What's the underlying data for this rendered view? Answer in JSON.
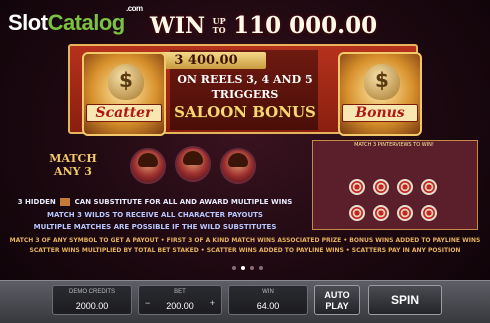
{
  "watermark": {
    "slot": "Slot",
    "catalog": "Catalog",
    "dotcom": ".com"
  },
  "headline": {
    "win": "WIN",
    "upto": "UP TO",
    "amount": "110 000.00"
  },
  "banner": {
    "bet_amount": "3 400.00",
    "line1": "ON REELS 3, 4 AND 5",
    "line2": "TRIGGERS",
    "line3": "SALOON BONUS"
  },
  "symbols": {
    "scatter": "Scatter",
    "bonus": "Bonus"
  },
  "match_any": "MATCH ANY 3",
  "preview": {
    "title": "MATCH 3 PINTERVIEWS TO WIN!"
  },
  "info": {
    "line1_pre": "3 HIDDEN",
    "line1_post": "CAN SUBSTITUTE FOR ALL AND AWARD MULTIPLE WINS",
    "line2": "MATCH 3 WILDS TO RECEIVE ALL CHARACTER PAYOUTS",
    "line3": "MULTIPLE MATCHES ARE POSSIBLE IF THE WILD SUBSTITUTES",
    "line4": "MATCH 3 OF ANY SYMBOL TO GET A PAYOUT • FIRST 3 OF A KIND MATCH WINS ASSOCIATED PRIZE • BONUS WINS ADDED TO PAYLINE WINS",
    "line5": "SCATTER WINS MULTIPLIED BY TOTAL BET STAKED • SCATTER WINS ADDED TO PAYLINE WINS • SCATTERS PAY IN ANY POSITION"
  },
  "controls": {
    "credits_label": "DEMO CREDITS",
    "credits_value": "2000.00",
    "bet_label": "BET",
    "bet_value": "200.00",
    "win_label": "WIN",
    "win_value": "64.00",
    "autoplay": "AUTO PLAY",
    "spin": "SPIN",
    "minus": "−",
    "plus": "+"
  },
  "pagination": {
    "pages": 4,
    "active": 1
  }
}
